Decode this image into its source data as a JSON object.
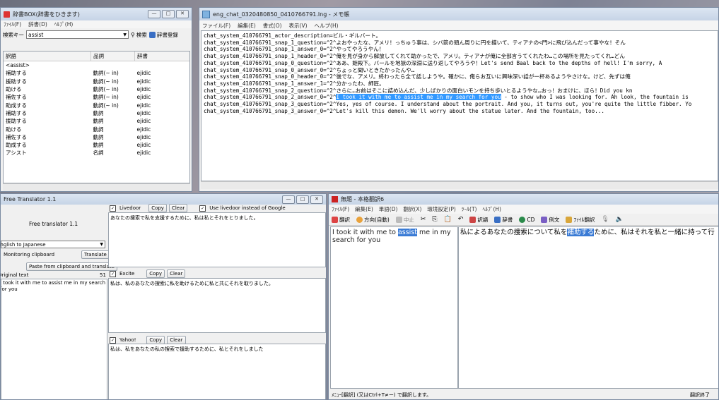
{
  "dict": {
    "title": "辞書BOX(辞書をひきます)",
    "menu": [
      "ﾌｧｲﾙ(F)",
      "辞書(D)",
      "ﾍﾙﾌﾟ(H)"
    ],
    "search_key_label": "検索キー",
    "search_value": "assist",
    "search_btn": "検索",
    "register_btn": "辞書登録",
    "columns": [
      "訳語",
      "品詞",
      "辞書"
    ],
    "rows": [
      {
        "word": "<assist>",
        "pos": "",
        "dict": ""
      },
      {
        "word": "補助する",
        "pos": "動詞(~ in)",
        "dict": "ejidic"
      },
      {
        "word": "援助する",
        "pos": "動詞(~ in)",
        "dict": "ejidic"
      },
      {
        "word": "助ける",
        "pos": "動詞(~ in)",
        "dict": "ejidic"
      },
      {
        "word": "補佐する",
        "pos": "動詞(~ in)",
        "dict": "ejidic"
      },
      {
        "word": "助成する",
        "pos": "動詞(~ in)",
        "dict": "ejidic"
      },
      {
        "word": "補助する",
        "pos": "動詞",
        "dict": "ejidic"
      },
      {
        "word": "援助する",
        "pos": "動詞",
        "dict": "ejidic"
      },
      {
        "word": "助ける",
        "pos": "動詞",
        "dict": "ejidic"
      },
      {
        "word": "補佐する",
        "pos": "動詞",
        "dict": "ejidic"
      },
      {
        "word": "助成する",
        "pos": "動詞",
        "dict": "ejidic"
      },
      {
        "word": "アシスト",
        "pos": "名詞",
        "dict": "ejidic"
      }
    ]
  },
  "notepad": {
    "title": "eng_chat_0320480850_0410766791.lng - メモ帳",
    "menu": [
      "ファイル(F)",
      "編集(E)",
      "書式(O)",
      "表示(V)",
      "ヘルプ(H)"
    ],
    "lines": [
      {
        "pre": "chat_system_410766791_actor_description=ビル・ギルバート。",
        "sel": "",
        "post": ""
      },
      {
        "pre": "chat_system_410766791_snap_1_question=^2^よおやったな、アメリ！っちゅう事は、シバ箭の頭ん周りに円を描いて、ティアナの<門>に飛び込んだって事やな！そん",
        "sel": "",
        "post": ""
      },
      {
        "pre": "chat_system_410766791_snap_1_answer_0=^2^やってやろうやん！",
        "sel": "",
        "post": ""
      },
      {
        "pre": "chat_system_410766791_snap_1_header_0=^2^俺を見が身から解放してくれて助かったで、アメリ。ティアナが俺に全部言うてくれたわ…この場所を見たってくれ…どん",
        "sel": "",
        "post": ""
      },
      {
        "pre": "chat_system_410766791_snap_0_question=^2^ああ、姫殿下。バールを地獄の深淵に送り返してやろうや！Let's send Baal back to the depths of hell! I'm sorry, A",
        "sel": "",
        "post": ""
      },
      {
        "pre": "chat_system_410766791_snap_0_answer_0=^2^ちょっと聞いときたかったんや…",
        "sel": "",
        "post": ""
      },
      {
        "pre": "chat_system_410766791_snap_0_header_0=^2^後でな、アメリ。終わったら全て話しようや。確かに、俺らお互いに興味深い話が一杯あるようやさけな。けど、先ずは俺",
        "sel": "",
        "post": ""
      },
      {
        "pre": "chat_system_410766791_snap_1_answer_1=^2^分かったわ、師匠。",
        "sel": "",
        "post": ""
      },
      {
        "pre": "chat_system_410766791_snap_2_question=^2^さらに…お前はそこに詰め込んだ、少しばかりの面白いモンを持ち歩いとるようやな…おっ！おまけに、ほら！Did you kn",
        "sel": "",
        "post": ""
      },
      {
        "pre": "chat_system_410766791_snap_2_answer_0=^2^",
        "sel": "I took it with me to assist me in my search for you",
        "post": " - to show who I was looking for. Ah look, the fountain is"
      },
      {
        "pre": "chat_system_410766791_snap_3_question=^2^Yes, yes of course. I understand about the portrait. And you, it turns out, you're quite the little fibber. Yo",
        "sel": "",
        "post": ""
      },
      {
        "pre": "chat_system_410766791_snap_3_answer_0=^2^Let's kill this demon. We'll worry about the statue later. And the fountain, too...",
        "sel": "",
        "post": ""
      }
    ]
  },
  "ft": {
    "title": "Free Translator 1.1",
    "app_name": "Free translator 1.1",
    "direction": "English to Japanese",
    "monitoring_label": "Monitoring clipboard",
    "translate_btn": "Translate",
    "paste_btn": "Paste from clipboard and translate",
    "original_label": "Original text",
    "original_count": "51",
    "original_text": "I took it with me to assist me in my search for you",
    "use_livedoor_label": "Use livedoor instead of Google",
    "copy": "Copy",
    "clear": "Clear",
    "engines": [
      {
        "name": "Livedoor",
        "result": "あなたの捜索で私を支援するために、私は私とそれをとりました。"
      },
      {
        "name": "Excite",
        "result": "私は、私のあなたの捜索に私を助けるために私と共にそれを取りました。"
      },
      {
        "name": "Yahoo!",
        "result": "私は、私をあなたの私の捜索で援助するために、私とそれをしました"
      }
    ]
  },
  "honyaku": {
    "title": "無題 - 本格翻訳6",
    "menu": [
      "ﾌｧｲﾙ(F)",
      "編集(E)",
      "単語(D)",
      "翻訳(X)",
      "環境設定(P)",
      "ﾂｰﾙ(T)",
      "ﾍﾙﾌﾟ(H)"
    ],
    "toolbar": [
      "翻訳",
      "方向(自動)",
      "中止",
      "訳語",
      "辞書",
      "CD",
      "例文",
      "ﾌｧｲﾙ翻訳"
    ],
    "source_pre": "I took it with me to ",
    "source_sel": "assist",
    "source_post": " me in my search for you",
    "target_pre": "私によるあなたの捜索について私を",
    "target_sel": "補助する",
    "target_post": "ために、私はそれを私と一緒に持って行",
    "status": "ﾒﾆｭｰ[翻訳] (又はCtrl+T≠ー) で翻訳します。",
    "status_right": "翻訳終了"
  }
}
